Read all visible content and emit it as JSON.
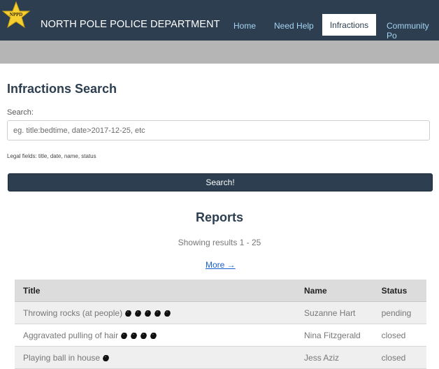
{
  "header": {
    "badge_text": "NPPD",
    "brand": "NORTH POLE POLICE DEPARTMENT",
    "nav": [
      {
        "label": "Home"
      },
      {
        "label": "Need Help"
      },
      {
        "label": "Infractions",
        "active": true
      },
      {
        "label": "Community Po"
      }
    ]
  },
  "search": {
    "title": "Infractions Search",
    "label": "Search:",
    "value": "",
    "placeholder": "eg. title:bedtime, date>2017-12-25, etc",
    "legal_fields": "Legal fields: title, date, name, status",
    "button_label": "Search!"
  },
  "reports": {
    "title": "Reports",
    "results_text": "Showing results 1 - 25",
    "more_label": "More →",
    "columns": [
      "Title",
      "Name",
      "Status"
    ],
    "rows": [
      {
        "title": "Throwing rocks (at people)",
        "coal": 5,
        "name": "Suzanne Hart",
        "status": "pending"
      },
      {
        "title": "Aggravated pulling of hair",
        "coal": 4,
        "name": "Nina Fitzgerald",
        "status": "closed"
      },
      {
        "title": "Playing ball in house",
        "coal": 1,
        "name": "Jess Aziz",
        "status": "closed"
      }
    ]
  },
  "colors": {
    "navbar": "#2c3e50",
    "nav_link": "#a6d4f2",
    "grey_band": "#b5b5b5",
    "star": "#f5cf2f",
    "link": "#1a5fd0"
  },
  "icons": {
    "badge": "star-badge-icon",
    "severity": "coal-lump-icon"
  }
}
